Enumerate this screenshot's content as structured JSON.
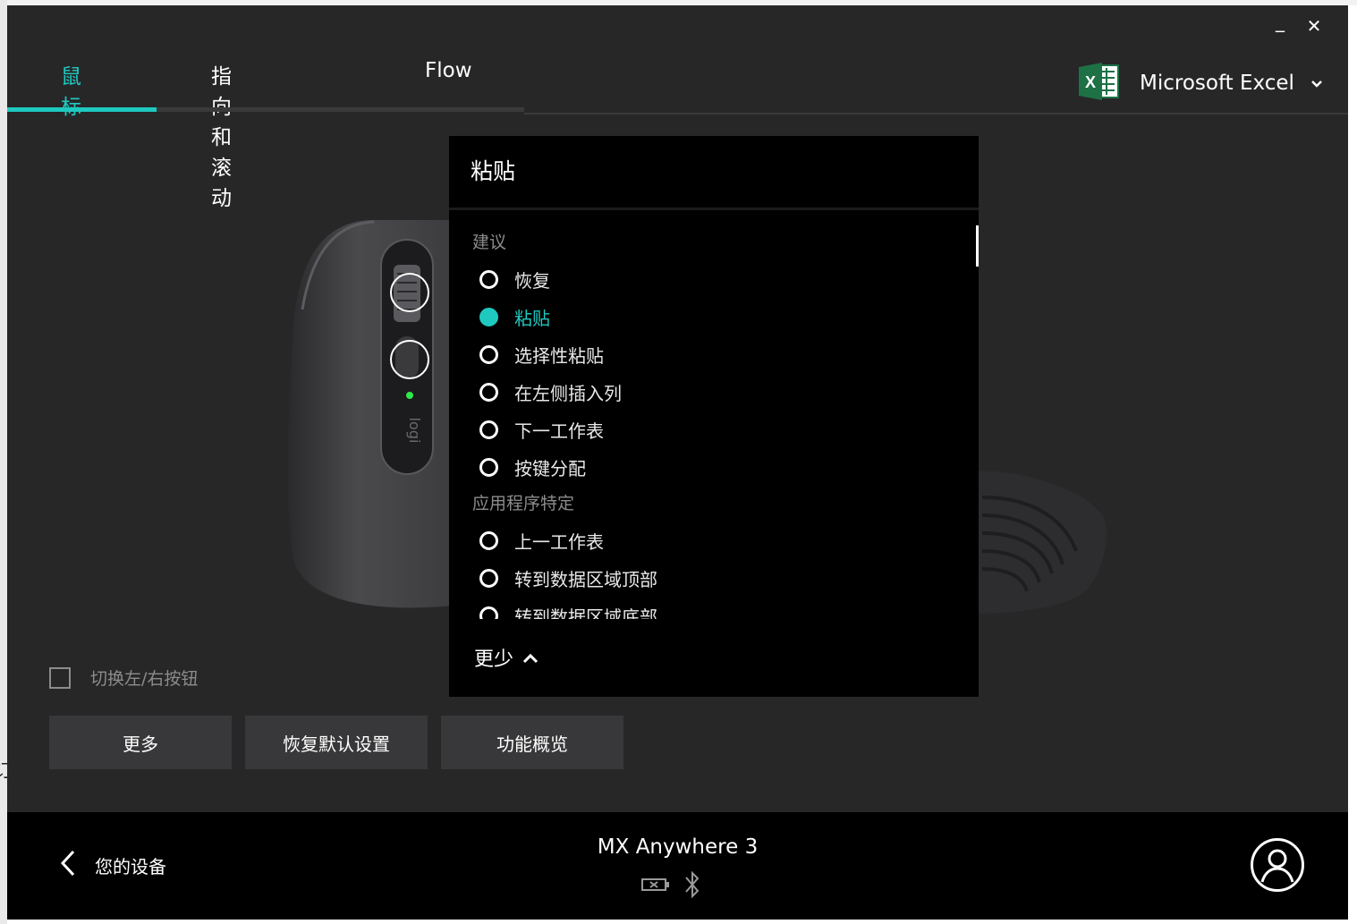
{
  "window": {
    "minimize_glyph": "_",
    "close_glyph": "✕"
  },
  "tabs": [
    {
      "label": "鼠标",
      "active": true
    },
    {
      "label": "指向和滚动",
      "active": false
    },
    {
      "label": "Flow",
      "active": false
    }
  ],
  "app_selector": {
    "name": "Microsoft Excel",
    "icon": "excel-icon"
  },
  "panel": {
    "title": "粘贴",
    "sections": [
      {
        "heading": "建议",
        "options": [
          "恢复",
          "粘贴",
          "选择性粘贴",
          "在左侧插入列",
          "下一工作表",
          "按键分配"
        ]
      },
      {
        "heading": "应用程序特定",
        "options": [
          "上一工作表",
          "转到数据区域顶部",
          "转到数据区域底部"
        ]
      }
    ],
    "selected": "粘贴",
    "less_label": "更少"
  },
  "swap_buttons_label": "切换左/右按钮",
  "buttons": {
    "more": "更多",
    "restore_defaults": "恢复默认设置",
    "overview": "功能概览"
  },
  "footer": {
    "back_label": "您的设备",
    "device_name": "MX Anywhere 3"
  },
  "colors": {
    "accent": "#1fc9c0",
    "background": "#272728",
    "panel": "#000000"
  }
}
